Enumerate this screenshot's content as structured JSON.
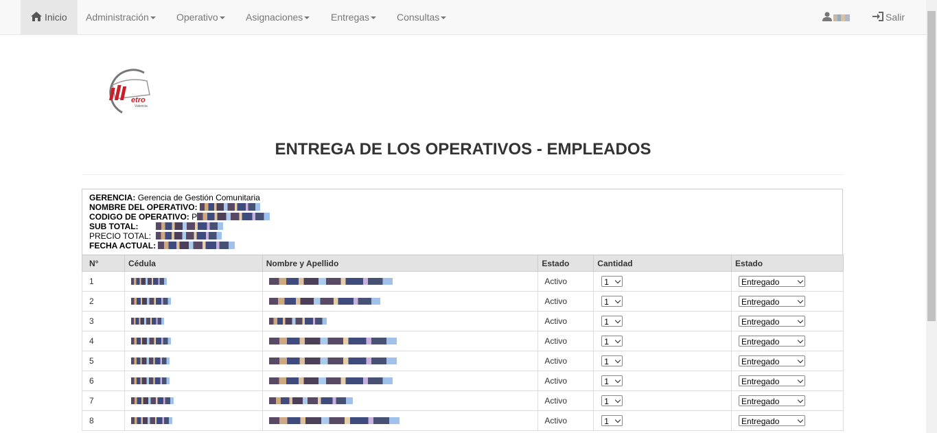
{
  "navbar": {
    "home_label": "Inicio",
    "menus": [
      {
        "label": "Administración"
      },
      {
        "label": "Operativo"
      },
      {
        "label": "Asignaciones"
      },
      {
        "label": "Entregas"
      },
      {
        "label": "Consultas"
      }
    ],
    "logout_label": "Salir"
  },
  "logo": {
    "text": "etro",
    "subtext": "Valencia"
  },
  "page": {
    "title": "ENTREGA DE LOS OPERATIVOS - EMPLEADOS"
  },
  "info": {
    "gerencia_label": "GERENCIA:",
    "gerencia_value": "Gerencia de Gestión Comunitaria",
    "nombre_label": "NOMBRE DEL OPERATIVO:",
    "codigo_label": "CODIGO DE OPERATIVO:",
    "codigo_prefix": "P",
    "subtotal_label": "SUB TOTAL:",
    "precio_label": "PRECIO TOTAL:",
    "fecha_label": "FECHA ACTUAL:"
  },
  "table": {
    "headers": [
      "N°",
      "Cédula",
      "Nombre y Apellido",
      "Estado",
      "Cantidad",
      "Estado"
    ],
    "rows": [
      {
        "n": "1",
        "estado": "Activo",
        "cantidad": "1",
        "entrega": "Entregado"
      },
      {
        "n": "2",
        "estado": "Activo",
        "cantidad": "1",
        "entrega": "Entregado"
      },
      {
        "n": "3",
        "estado": "Activo",
        "cantidad": "1",
        "entrega": "Entregado"
      },
      {
        "n": "4",
        "estado": "Activo",
        "cantidad": "1",
        "entrega": "Entregado"
      },
      {
        "n": "5",
        "estado": "Activo",
        "cantidad": "1",
        "entrega": "Entregado"
      },
      {
        "n": "6",
        "estado": "Activo",
        "cantidad": "1",
        "entrega": "Entregado"
      },
      {
        "n": "7",
        "estado": "Activo",
        "cantidad": "1",
        "entrega": "Entregado"
      },
      {
        "n": "8",
        "estado": "Activo",
        "cantidad": "1",
        "entrega": "Entregado"
      }
    ]
  },
  "colors": {
    "navbar_bg": "#f8f8f8",
    "active_tab_bg": "#e7e7e7",
    "header_row_bg": "#e3e3e3",
    "logo_red": "#c8202a"
  },
  "icons": {
    "home": "home-icon",
    "user": "user-icon",
    "logout": "log-in-icon"
  }
}
